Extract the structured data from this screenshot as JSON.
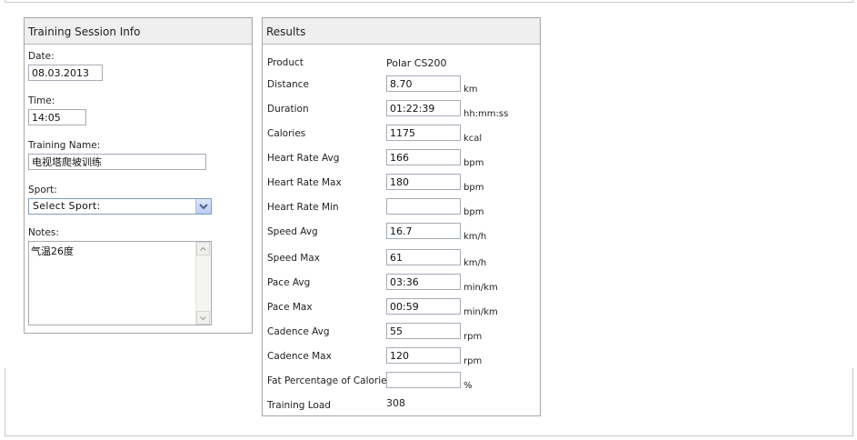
{
  "session_panel": {
    "title": "Training Session Info",
    "date": {
      "label": "Date:",
      "value": "08.03.2013"
    },
    "time": {
      "label": "Time:",
      "value": "14:05"
    },
    "training_name": {
      "label": "Training Name:",
      "value": "电视塔爬坡训练"
    },
    "sport": {
      "label": "Sport:",
      "selected": "Select Sport:"
    },
    "notes": {
      "label": "Notes:",
      "value": "气温26度"
    }
  },
  "results_panel": {
    "title": "Results",
    "product": {
      "label": "Product",
      "value": "Polar CS200"
    },
    "rows": [
      {
        "label": "Distance",
        "value": "8.70",
        "unit": "km"
      },
      {
        "label": "Duration",
        "value": "01:22:39",
        "unit": "hh:mm:ss"
      },
      {
        "label": "Calories",
        "value": "1175",
        "unit": "kcal"
      },
      {
        "label": "Heart Rate Avg",
        "value": "166",
        "unit": "bpm"
      },
      {
        "label": "Heart Rate Max",
        "value": "180",
        "unit": "bpm"
      },
      {
        "label": "Heart Rate Min",
        "value": "",
        "unit": "bpm"
      },
      {
        "label": "Speed Avg",
        "value": "16.7",
        "unit": "km/h"
      },
      {
        "label": "Speed Max",
        "value": "61",
        "unit": "km/h"
      },
      {
        "label": "Pace Avg",
        "value": "03:36",
        "unit": "min/km"
      },
      {
        "label": "Pace Max",
        "value": "00:59",
        "unit": "min/km"
      },
      {
        "label": "Cadence Avg",
        "value": "55",
        "unit": "rpm"
      },
      {
        "label": "Cadence Max",
        "value": "120",
        "unit": "rpm"
      },
      {
        "label": "Fat Percentage of Calories",
        "value": "",
        "unit": "%"
      }
    ],
    "training_load": {
      "label": "Training Load",
      "value": "308"
    }
  },
  "icons": {
    "dropdown": "chevron-down-icon",
    "scroll_up": "scroll-up-arrow-icon",
    "scroll_down": "scroll-down-arrow-icon"
  },
  "colors": {
    "panel_header_bg": "#efefef",
    "panel_border": "#a6a6a6",
    "select_button": "#b7cbf3",
    "select_arrow": "#4d6185"
  }
}
